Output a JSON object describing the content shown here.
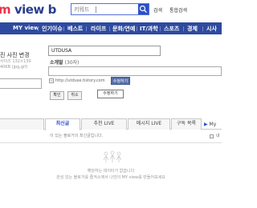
{
  "header": {
    "logo_m": "m",
    "logo_view": "view",
    "logo_b": "b",
    "search_placeholder": "키워드",
    "detail_search": "검색",
    "unified_search": "통합검색"
  },
  "nav": {
    "items": [
      "MY view",
      "인기이슈",
      "베스트",
      "라이프",
      "문화/연예",
      "IT/과학",
      "스포츠",
      "경제",
      "시사"
    ]
  },
  "profile": {
    "change_photo": "진 사진 변경",
    "photo_size_info": "사이즈 132×130",
    "photo_format_info": "40KB (jpg,gif)",
    "blog_name": "UTDUSA",
    "intro_label": "소개말",
    "intro_count": "(30자)",
    "intro_value": "",
    "url": "http://utduse.tistory.com",
    "edit_button": "수정하기",
    "edit_tooltip": "수정하기",
    "confirm_button": "확인",
    "cancel_button": "취소"
  },
  "tabs": {
    "items": [
      "",
      "최신글",
      "추천 LIVE",
      "메시지 LIVE",
      "구독 목록"
    ],
    "active_index": 1,
    "my_link": "My"
  },
  "notice_text": "이 있는 블로거의 최신글입니다.",
  "right_check_label": "내",
  "empty_state": {
    "main": "해당하는 데이터가 없습니다",
    "sub": "관심 있는 블로거를 즐겨소에서 나만의 MY view를 만들어보세요"
  },
  "colors": {
    "nav_bg": "#2e4a9f",
    "accent_blue": "#2b50c9",
    "logo_red": "#e8354a"
  }
}
